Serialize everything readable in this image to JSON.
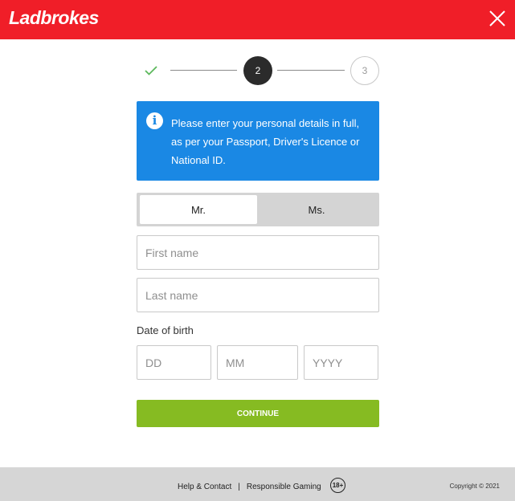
{
  "header": {
    "logo_text": "Ladbrokes",
    "close_icon": "close-icon",
    "brand_color": "#f01e28"
  },
  "stepper": {
    "step1_icon": "check-icon",
    "step2_label": "2",
    "step3_label": "3",
    "current_step": 2
  },
  "info": {
    "icon": "info-icon",
    "text": "Please enter your personal details in full, as per your Passport, Driver's Licence or National ID."
  },
  "title_options": {
    "mr": "Mr.",
    "ms": "Ms.",
    "selected": "Mr."
  },
  "form": {
    "first_name_placeholder": "First name",
    "last_name_placeholder": "Last name",
    "dob_label": "Date of birth",
    "dd_placeholder": "DD",
    "mm_placeholder": "MM",
    "yyyy_placeholder": "YYYY",
    "continue_label": "CONTINUE",
    "continue_color": "#86bb22"
  },
  "footer": {
    "help_link": "Help & Contact",
    "separator": "|",
    "responsible_link": "Responsible Gaming",
    "age_badge": "18+",
    "copyright": "Copyright © 2021"
  }
}
